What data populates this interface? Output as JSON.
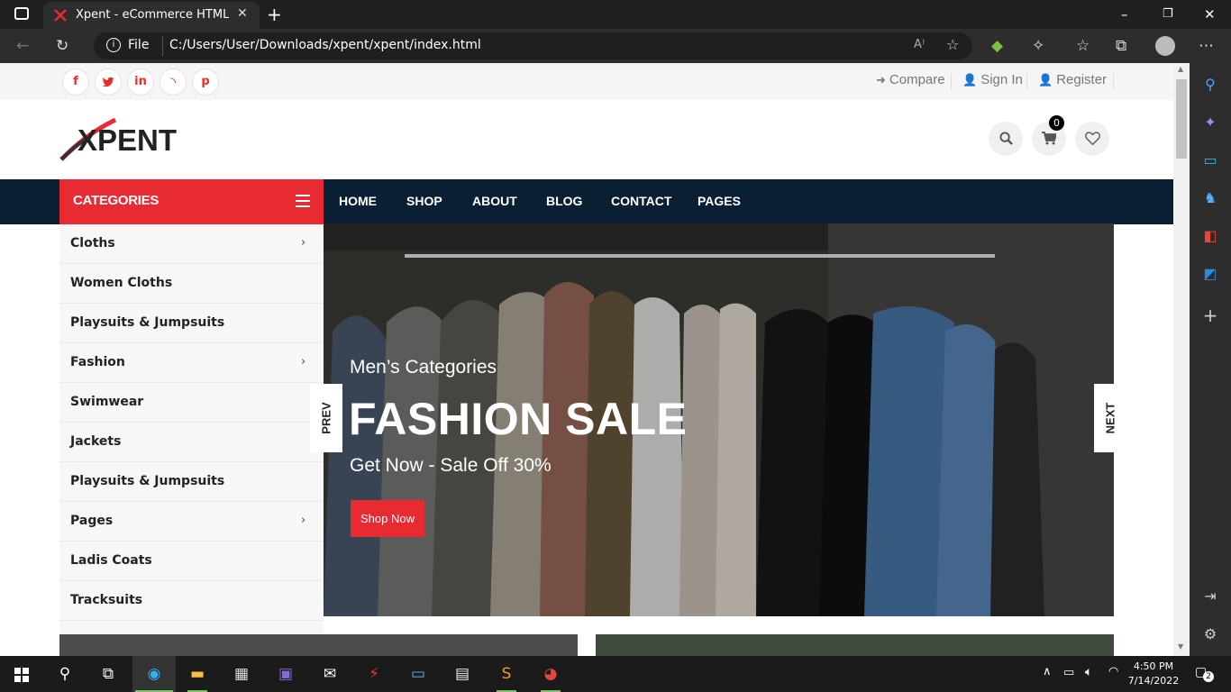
{
  "browser": {
    "tab_title": "Xpent - eCommerce HTML Temp",
    "file_label": "File",
    "url": "C:/Users/User/Downloads/xpent/xpent/index.html"
  },
  "topbar": {
    "social": [
      "f",
      "t",
      "in",
      "rss",
      "p"
    ],
    "compare": "Compare",
    "signin": "Sign In",
    "register": "Register"
  },
  "header": {
    "logo_text": "XPENT",
    "cart_count": "0"
  },
  "menu": {
    "categories_label": "CATEGORIES",
    "items": [
      "HOME",
      "SHOP",
      "ABOUT",
      "BLOG",
      "CONTACT",
      "PAGES"
    ]
  },
  "categories": [
    {
      "label": "Cloths",
      "arrow": "›"
    },
    {
      "label": "Women Cloths",
      "arrow": ""
    },
    {
      "label": "Playsuits & Jumpsuits",
      "arrow": ""
    },
    {
      "label": "Fashion",
      "arrow": "›"
    },
    {
      "label": "Swimwear",
      "arrow": ""
    },
    {
      "label": "Jackets",
      "arrow": ""
    },
    {
      "label": "Playsuits & Jumpsuits",
      "arrow": ""
    },
    {
      "label": "Pages",
      "arrow": "›"
    },
    {
      "label": "Ladis Coats",
      "arrow": ""
    },
    {
      "label": "Tracksuits",
      "arrow": ""
    }
  ],
  "hero": {
    "subtitle": "Men’s Categories",
    "title": "FASHION SALE",
    "offer": "Get Now - Sale Off 30%",
    "button": "Shop Now",
    "prev": "PREV",
    "next": "NEXT"
  },
  "taskbar": {
    "time": "4:50 PM",
    "date": "7/14/2022",
    "notifications": "2"
  },
  "colors": {
    "accent": "#e82a33",
    "navy": "#0a1f33"
  }
}
